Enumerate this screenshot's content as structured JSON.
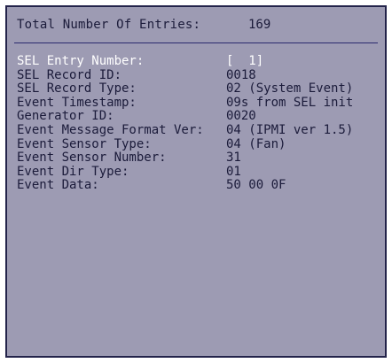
{
  "header": {
    "label": "Total Number Of Entries:",
    "value": "169"
  },
  "entries": [
    {
      "label": "SEL Entry Number:",
      "value": "[  1]",
      "selected": true
    },
    {
      "label": "SEL Record ID:",
      "value": "0018"
    },
    {
      "label": "SEL Record Type:",
      "value": "02 (System Event)"
    },
    {
      "label": "Event Timestamp:",
      "value": "09s from SEL init"
    },
    {
      "label": "Generator ID:",
      "value": "0020"
    },
    {
      "label": "Event Message Format Ver:",
      "value": "04 (IPMI ver 1.5)"
    },
    {
      "label": "Event Sensor Type:",
      "value": "04 (Fan)"
    },
    {
      "label": "Event Sensor Number:",
      "value": "31"
    },
    {
      "label": "Event Dir Type:",
      "value": "01"
    },
    {
      "label": "Event Data:",
      "value": "50 00 0F"
    }
  ],
  "colors": {
    "panel_background": "#9d9bb3",
    "text": "#1b1b3a",
    "selected_text": "#ffffff",
    "divider": "#2a2a6e"
  }
}
